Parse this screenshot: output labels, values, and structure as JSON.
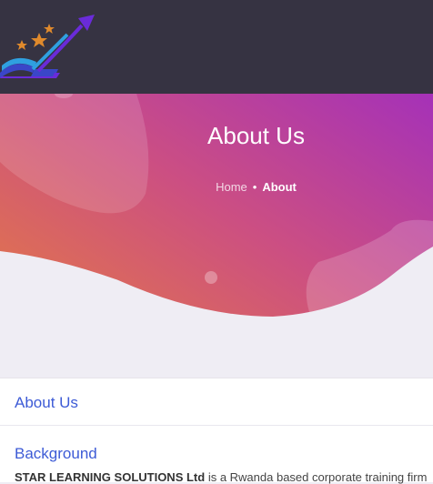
{
  "header": {
    "logo_icon": "star-learning-book-arrow-logo"
  },
  "hero": {
    "title": "About Us",
    "breadcrumb": {
      "home": "Home",
      "separator": "•",
      "current": "About"
    },
    "colors": {
      "gradient_start": "#e8813a",
      "gradient_end": "#a531b8"
    }
  },
  "content": {
    "section_title": "About Us",
    "background_title": "Background",
    "background_company": "STAR LEARNING SOLUTIONS Ltd",
    "background_text": " is a Rwanda based corporate training firm"
  }
}
